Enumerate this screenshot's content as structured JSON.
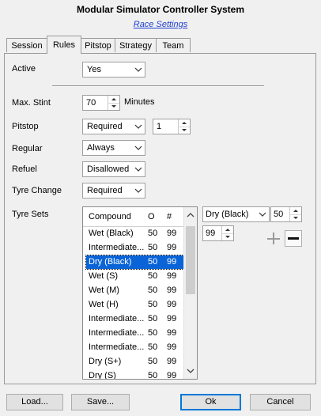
{
  "window": {
    "title": "Modular Simulator Controller System",
    "link": "Race Settings"
  },
  "tabs": [
    {
      "label": "Session",
      "active": false
    },
    {
      "label": "Rules",
      "active": true
    },
    {
      "label": "Pitstop",
      "active": false
    },
    {
      "label": "Strategy",
      "active": false
    },
    {
      "label": "Team",
      "active": false
    }
  ],
  "rules": {
    "active": {
      "label": "Active",
      "value": "Yes"
    },
    "max_stint": {
      "label": "Max. Stint",
      "value": "70",
      "unit": "Minutes"
    },
    "pitstop": {
      "label": "Pitstop",
      "value": "Required",
      "count": "1"
    },
    "regular": {
      "label": "Regular",
      "value": "Always"
    },
    "refuel": {
      "label": "Refuel",
      "value": "Disallowed"
    },
    "tyre_change": {
      "label": "Tyre Change",
      "value": "Required"
    },
    "tyre_sets": {
      "label": "Tyre Sets",
      "columns": [
        "Compound",
        "O",
        "#"
      ],
      "rows": [
        {
          "compound": "Wet (Black)",
          "o": "50",
          "n": "99",
          "selected": false
        },
        {
          "compound": "Intermediate...",
          "o": "50",
          "n": "99",
          "selected": false
        },
        {
          "compound": "Dry (Black)",
          "o": "50",
          "n": "99",
          "selected": true
        },
        {
          "compound": "Wet (S)",
          "o": "50",
          "n": "99",
          "selected": false
        },
        {
          "compound": "Wet (M)",
          "o": "50",
          "n": "99",
          "selected": false
        },
        {
          "compound": "Wet (H)",
          "o": "50",
          "n": "99",
          "selected": false
        },
        {
          "compound": "Intermediate...",
          "o": "50",
          "n": "99",
          "selected": false
        },
        {
          "compound": "Intermediate...",
          "o": "50",
          "n": "99",
          "selected": false
        },
        {
          "compound": "Intermediate...",
          "o": "50",
          "n": "99",
          "selected": false
        },
        {
          "compound": "Dry (S+)",
          "o": "50",
          "n": "99",
          "selected": false
        },
        {
          "compound": "Dry (S)",
          "o": "50",
          "n": "99",
          "selected": false
        }
      ],
      "editor": {
        "compound": "Dry (Black)",
        "o": "50",
        "n": "99"
      }
    }
  },
  "buttons": {
    "load": "Load...",
    "save": "Save...",
    "ok": "Ok",
    "cancel": "Cancel"
  },
  "colors": {
    "selection": "#0a64d8",
    "link": "#1f3fcf"
  }
}
